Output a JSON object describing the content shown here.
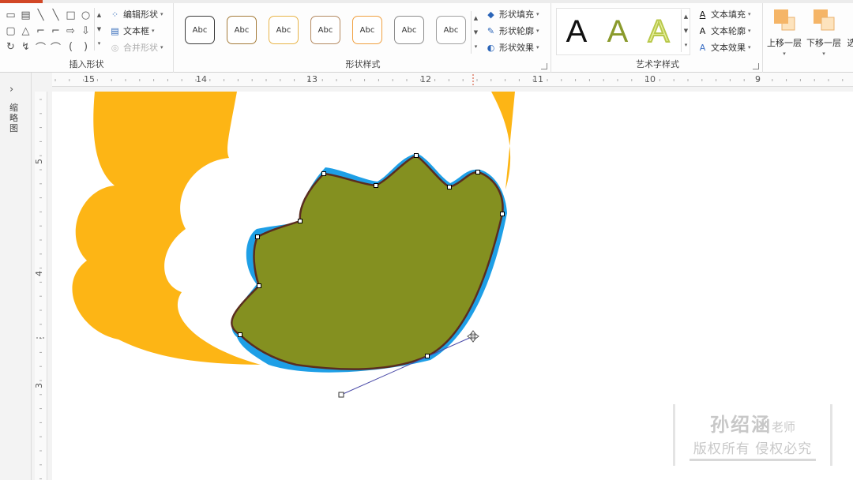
{
  "ribbon": {
    "insert_shapes": {
      "label": "插入形状",
      "edit_shape": "编辑形状",
      "text_box": "文本框",
      "merge_shapes": "合并形状",
      "shape_glyphs": [
        "▭",
        "▤",
        "╲",
        "╲",
        "□",
        "○",
        "▢",
        "△",
        "⌐",
        "⌐",
        "⇨",
        "⇩",
        "↻",
        "↯",
        "⌒",
        "⌒",
        "(",
        ")"
      ]
    },
    "shape_styles": {
      "label": "形状样式",
      "preset_label": "Abc",
      "presets": [
        {
          "border": "#3c3c3c"
        },
        {
          "border": "#a57c3a"
        },
        {
          "border": "#e8b54a"
        },
        {
          "border": "#b48a62"
        },
        {
          "border": "#f0a040"
        },
        {
          "border": "#8c8c8c"
        },
        {
          "border": "#a0a0a0"
        }
      ],
      "fill": "形状填充",
      "outline": "形状轮廓",
      "effects": "形状效果"
    },
    "wordart": {
      "label": "艺术字样式",
      "glyph": "A",
      "text_fill": "文本填充",
      "text_outline": "文本轮廓",
      "text_effects": "文本效果"
    },
    "arrange": {
      "bring_forward": "上移一层",
      "send_backward": "下移一层",
      "select_pane": "选"
    }
  },
  "left_pane": {
    "label": "缩略图"
  },
  "ruler": {
    "horizontal": [
      "15",
      "14",
      "13",
      "12",
      "11",
      "10",
      "9"
    ],
    "vertical": [
      "5",
      "4",
      "3"
    ]
  },
  "canvas": {
    "colors": {
      "petal_outer": "#fdb515",
      "petal_middle": "#ffffff",
      "shadow": "#1e9fe6",
      "shape_fill": "#849020",
      "shape_outline": "#5a2d1f",
      "handle_line": "#4a4aa8"
    }
  },
  "watermark": {
    "name": "孙绍涵",
    "title": "老师",
    "notice": "版权所有 侵权必究"
  }
}
